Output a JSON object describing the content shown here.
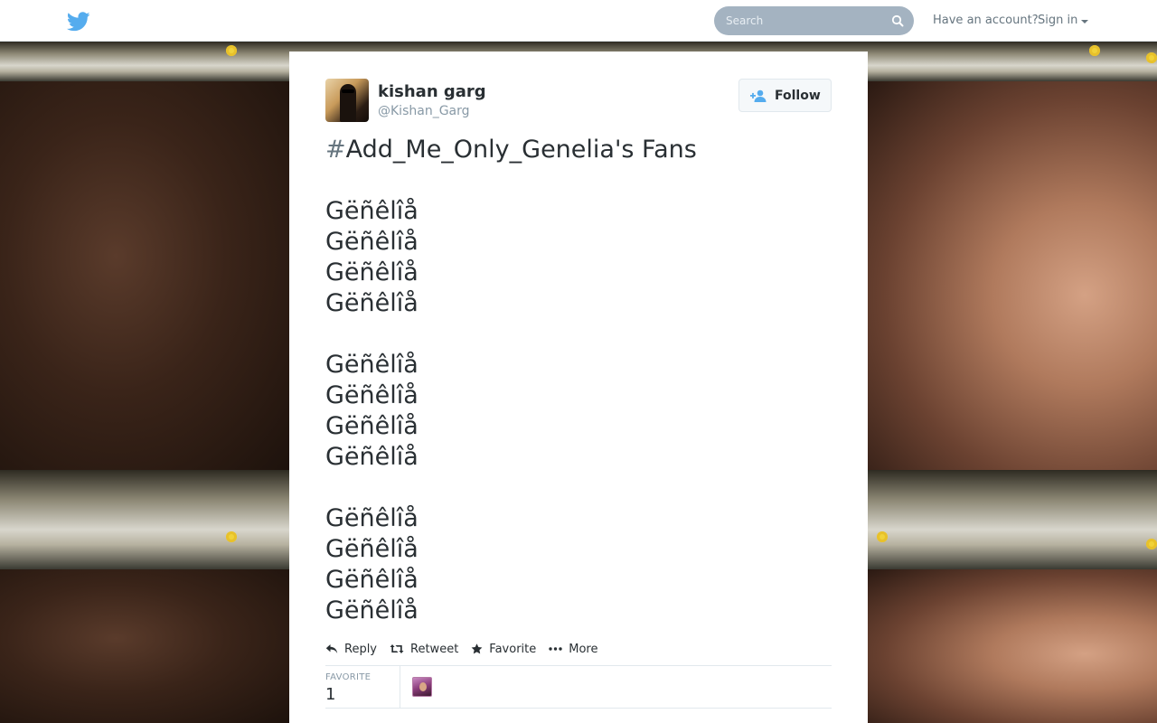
{
  "topbar": {
    "logo_icon": "twitter-bird-icon",
    "search_placeholder": "Search",
    "search_icon": "search-icon",
    "account_prompt": "Have an account?",
    "signin_label": "Sign in",
    "caret_icon": "chevron-down-icon"
  },
  "tweet": {
    "author": {
      "fullname": "kishan garg",
      "screen_name": "@Kishan_Garg"
    },
    "follow_label": "Follow",
    "text": {
      "hash": "#",
      "hashtag": "Add_Me_Only_Genelia",
      "suffix": "'s Fans",
      "word": "Gëñêlîå"
    },
    "actions": {
      "reply": "Reply",
      "retweet": "Retweet",
      "favorite": "Favorite",
      "more": "More"
    },
    "stats": {
      "favorite_label": "FAVORITE",
      "favorite_count": "1"
    }
  },
  "colors": {
    "brand": "#55acee",
    "text": "#292f33",
    "muted": "#8899a6",
    "search_bg": "#a4b3c1"
  }
}
